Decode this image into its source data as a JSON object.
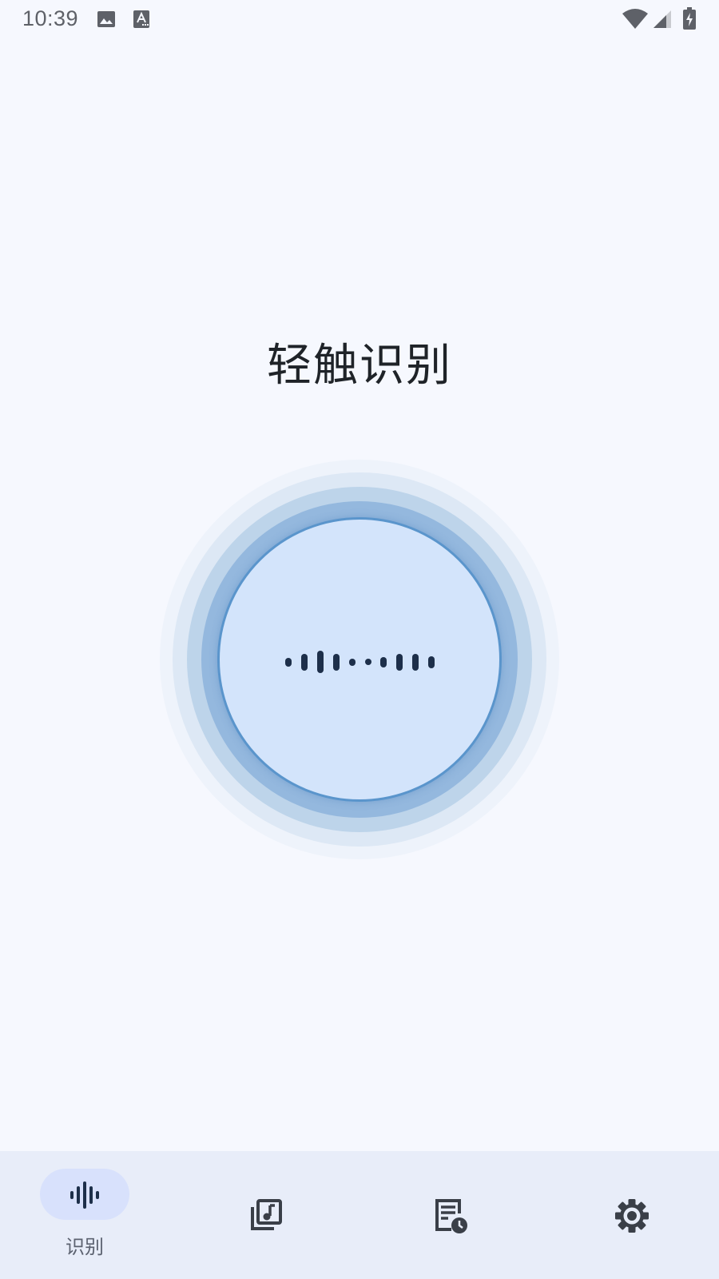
{
  "status_bar": {
    "time": "10:39",
    "icons": [
      "image-icon",
      "text-a-icon",
      "wifi-icon",
      "cellular-signal-icon",
      "battery-charging-icon"
    ]
  },
  "main": {
    "title": "轻触识别",
    "recognize_button_icon": "sound-wave-icon"
  },
  "bottom_nav": {
    "items": [
      {
        "label": "识别",
        "icon": "sound-wave-icon",
        "selected": true
      },
      {
        "label": "",
        "icon": "music-library-icon",
        "selected": false
      },
      {
        "label": "",
        "icon": "history-list-icon",
        "selected": false
      },
      {
        "label": "",
        "icon": "gear-icon",
        "selected": false
      }
    ]
  },
  "colors": {
    "background": "#f6f8fe",
    "nav_background": "#e8edf9",
    "selected_pill": "#d8e1fc",
    "button_fill": "#d3e4fb",
    "button_border": "#5a95cc",
    "icon_dark": "#1d2f4a"
  }
}
